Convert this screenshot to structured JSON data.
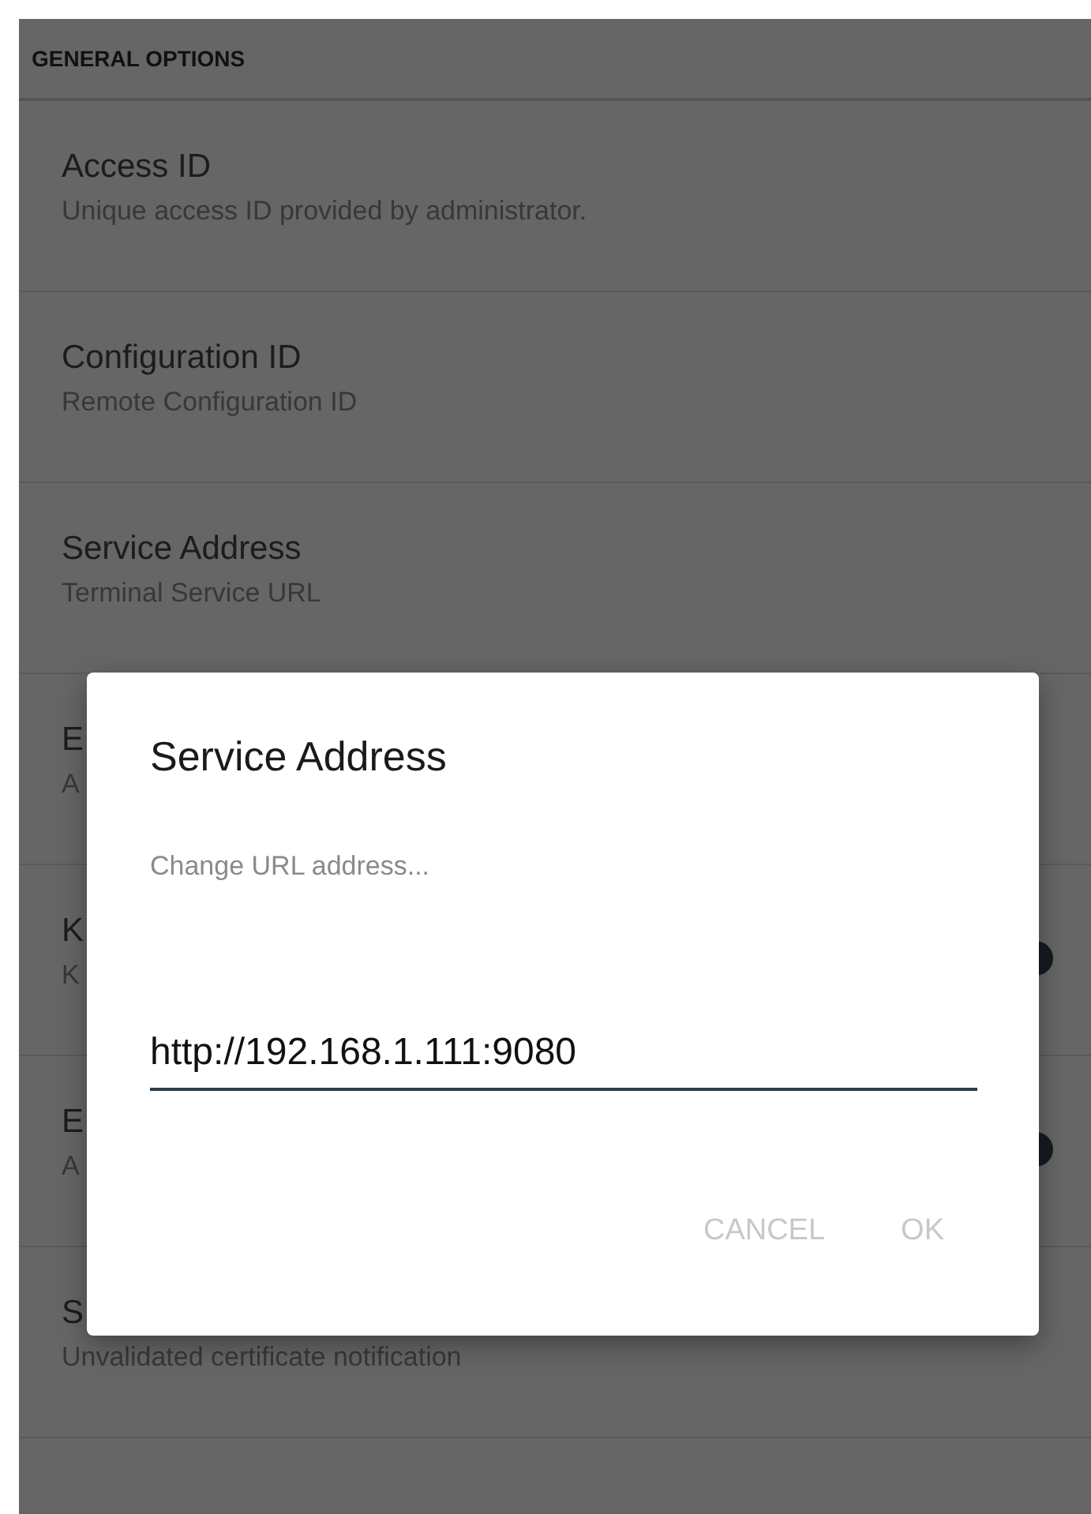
{
  "section": {
    "title": "GENERAL OPTIONS"
  },
  "items": [
    {
      "kind": "text",
      "title": "Access ID",
      "subtitle": "Unique access ID provided by administrator."
    },
    {
      "kind": "text",
      "title": "Configuration ID",
      "subtitle": "Remote Configuration ID"
    },
    {
      "kind": "text",
      "title": "Service Address",
      "subtitle": "Terminal Service URL"
    },
    {
      "kind": "text",
      "title": "E",
      "subtitle": "A"
    },
    {
      "kind": "switch",
      "title": "K",
      "subtitle": "K",
      "on": true
    },
    {
      "kind": "switch",
      "title": "E",
      "subtitle": "A",
      "on": true
    },
    {
      "kind": "text",
      "title": "S",
      "subtitle": "Unvalidated certificate notification"
    }
  ],
  "dialog": {
    "title": "Service Address",
    "message": "Change URL address...",
    "value": "http://192.168.1.111:9080",
    "buttons": [
      "CANCEL",
      "OK"
    ]
  }
}
